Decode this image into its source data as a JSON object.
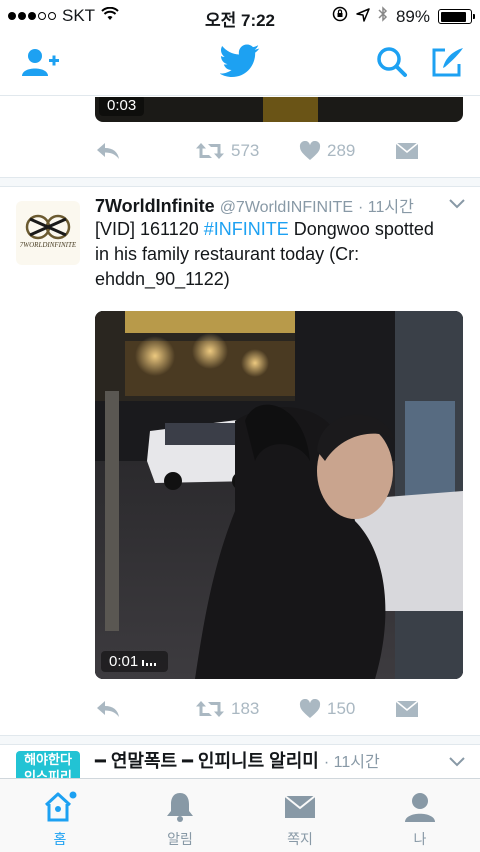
{
  "status_bar": {
    "carrier": "SKT",
    "time": "오전 7:22",
    "battery": "89%",
    "battery_level": 0.89
  },
  "nav": {
    "icons": [
      "add-user-icon",
      "twitter-bird-icon",
      "search-icon",
      "compose-icon"
    ]
  },
  "previous_tweet": {
    "video_duration": "0:03",
    "retweets": "573",
    "likes": "289"
  },
  "tweet": {
    "display_name": "7WorldInfinite",
    "handle": "@7WorldINFINITE",
    "time": "· 11시간",
    "text_prefix": "[VID] 161120 ",
    "hashtag": "#INFINITE",
    "text_suffix": " Dongwoo spotted in his family restaurant today (Cr: ehddn_90_1122)",
    "avatar_text": "7WORLDINFINITE",
    "video_duration": "0:01",
    "retweets": "183",
    "likes": "150"
  },
  "next_tweet": {
    "display_name": "━ 연말폭트 ━ 인피니트 알리미",
    "time": "· 11시간",
    "avatar_text_line1": "해야한다",
    "avatar_text_line2": "인스피리"
  },
  "tabbar": {
    "tabs": [
      {
        "label": "홈",
        "icon": "home-icon",
        "active": true
      },
      {
        "label": "알림",
        "icon": "bell-icon",
        "active": false
      },
      {
        "label": "쪽지",
        "icon": "envelope-icon",
        "active": false
      },
      {
        "label": "나",
        "icon": "profile-icon",
        "active": false
      }
    ]
  },
  "colors": {
    "accent": "#1da1f2",
    "muted": "#aab8c2"
  }
}
